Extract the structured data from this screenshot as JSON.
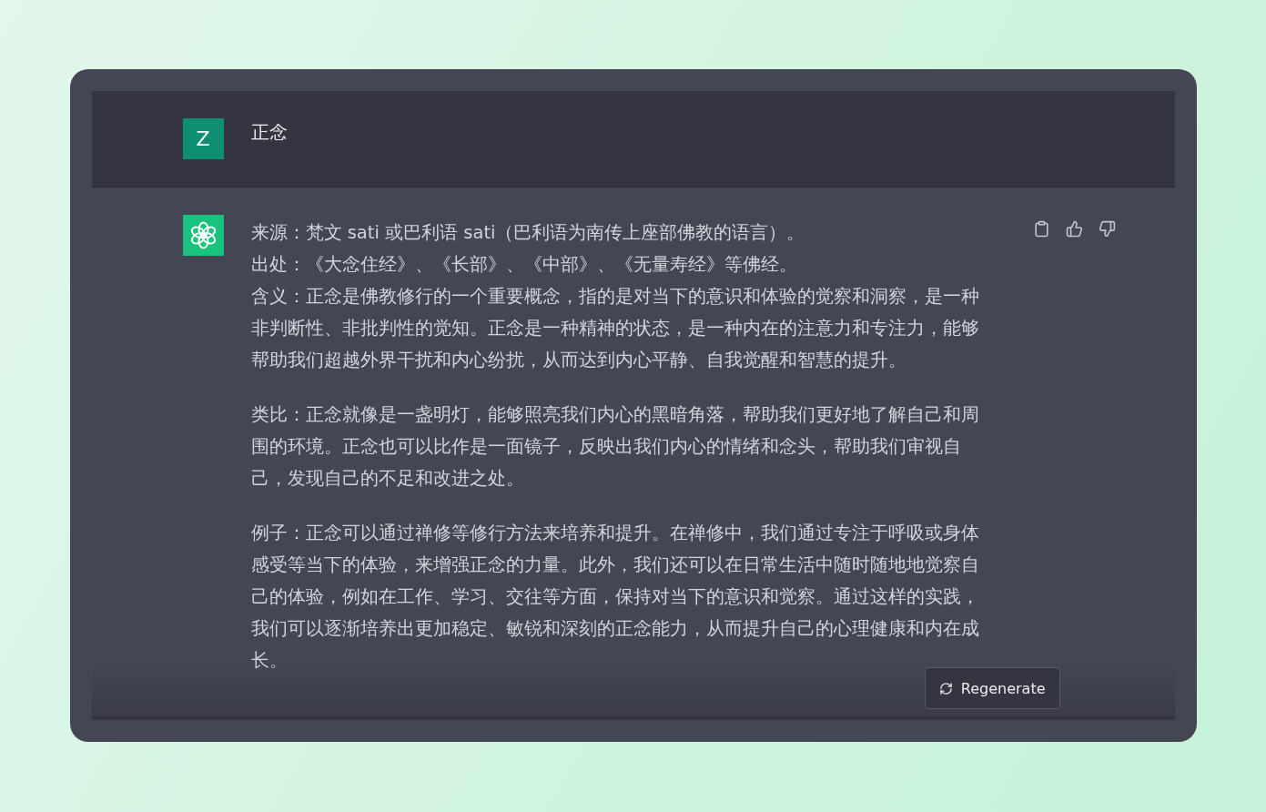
{
  "user_message": {
    "avatar_letter": "Z",
    "text": "正念"
  },
  "assistant_message": {
    "paragraphs": [
      {
        "lines": [
          "来源：梵文 sati 或巴利语 sati（巴利语为南传上座部佛教的语言）。",
          "出处：《大念住经》、《长部》、《中部》、《无量寿经》等佛经。",
          "含义：正念是佛教修行的一个重要概念，指的是对当下的意识和体验的觉察和洞察，是一种非判断性、非批判性的觉知。正念是一种精神的状态，是一种内在的注意力和专注力，能够帮助我们超越外界干扰和内心纷扰，从而达到内心平静、自我觉醒和智慧的提升。"
        ]
      },
      {
        "lines": [
          "类比：正念就像是一盏明灯，能够照亮我们内心的黑暗角落，帮助我们更好地了解自己和周围的环境。正念也可以比作是一面镜子，反映出我们内心的情绪和念头，帮助我们审视自己，发现自己的不足和改进之处。"
        ]
      },
      {
        "lines": [
          "例子：正念可以通过禅修等修行方法来培养和提升。在禅修中，我们通过专注于呼吸或身体感受等当下的体验，来增强正念的力量。此外，我们还可以在日常生活中随时随地地觉察自己的体验，例如在工作、学习、交往等方面，保持对当下的意识和觉察。通过这样的实践，我们可以逐渐培养出更加稳定、敏锐和深刻的正念能力，从而提升自己的心理健康和内在成长。"
        ]
      }
    ]
  },
  "regenerate_button": {
    "label": "Regenerate"
  }
}
